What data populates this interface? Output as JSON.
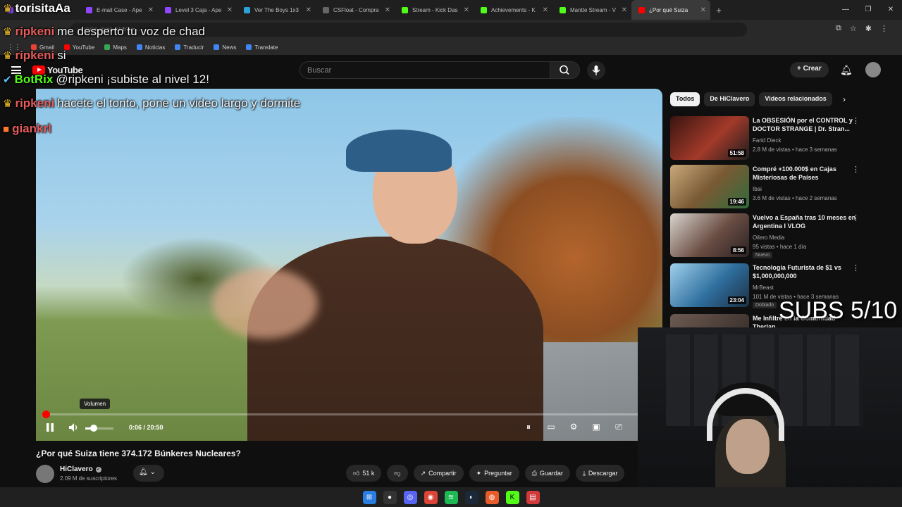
{
  "browser": {
    "tabs": [
      {
        "label": "torisitaAa:",
        "color": "#7b3fe4"
      },
      {
        "label": "E-mail Case - Ape",
        "color": "#9146ff"
      },
      {
        "label": "Level 3 Caja - Ape",
        "color": "#9146ff"
      },
      {
        "label": "Ver The Boys 1x3",
        "color": "#2aa3d8"
      },
      {
        "label": "CSFloat - Compra",
        "color": "#666666"
      },
      {
        "label": "Stream - Kick Das",
        "color": "#53fc18"
      },
      {
        "label": "Achievements - K",
        "color": "#53fc18"
      },
      {
        "label": "Mantte Stream - V",
        "color": "#53fc18"
      },
      {
        "label": "¿Por qué Suiza",
        "color": "#ff0000",
        "active": true
      }
    ],
    "new_tab": "+",
    "url": "youtube.com/watch?v=...",
    "bookmarks": [
      {
        "label": "Gmail",
        "color": "#ea4335"
      },
      {
        "label": "YouTube",
        "color": "#ff0000"
      },
      {
        "label": "Maps",
        "color": "#34a853"
      },
      {
        "label": "Noticias",
        "color": "#4285f4"
      },
      {
        "label": "Traducir",
        "color": "#4285f4"
      },
      {
        "label": "News",
        "color": "#4285f4"
      },
      {
        "label": "Translate",
        "color": "#4285f4"
      }
    ]
  },
  "youtube": {
    "logo_text": "YouTube",
    "search_placeholder": "Buscar",
    "create_label": "+ Crear",
    "video": {
      "title": "¿Por qué Suiza tiene 374.172 Búnkeres Nucleares?",
      "current_time": "0:06",
      "duration": "20:50",
      "time_display": "0:06 / 20:50",
      "progress": 0.005,
      "volume": 0.3,
      "volume_tooltip": "Volumen"
    },
    "channel": {
      "name": "HiClavero",
      "subscribers": "2.09 M de suscriptores"
    },
    "actions": {
      "likes": "51 k",
      "share": "Compartir",
      "ask": "Preguntar",
      "save": "Guardar",
      "download": "Descargar"
    },
    "chips": [
      "Todos",
      "De HiClavero",
      "Videos relacionados"
    ],
    "recommendations": [
      {
        "title": "La OBSESIÓN por el CONTROL y DOCTOR STRANGE | Dr. Stran...",
        "channel": "Farid Dieck",
        "meta": "2.8 M de vistas • hace 3 semanas",
        "duration": "51:58",
        "thumb": "#6c2a24"
      },
      {
        "title": "Compré +100.000$ en Cajas Misteriosas de Países",
        "channel": "Ibai",
        "meta": "3.6 M de vistas • hace 2 semanas",
        "duration": "19:46",
        "thumb": "#8b6a3a"
      },
      {
        "title": "Vuelvo a España tras 10 meses en Argentina I VLOG",
        "channel": "Oilero Media",
        "meta": "95 vistas • hace 1 día",
        "duration": "8:56",
        "badge": "Nuevo",
        "thumb": "#5b4a44"
      },
      {
        "title": "Tecnologia Futurista de $1 vs $1,000,000,000",
        "channel": "MrBeast",
        "meta": "101 M de vistas • hace 3 semanas",
        "duration": "23:04",
        "badge": "Doblado",
        "thumb": "#3a6c9a"
      },
      {
        "title": "Me Infiltré en la Comunidad Therian",
        "channel": "",
        "meta": "",
        "duration": "",
        "thumb": "#4a3c3a"
      }
    ]
  },
  "overlay": {
    "chat": [
      {
        "user": "torisitaAa",
        "message": ""
      },
      {
        "user": "ripkeni",
        "message": "me desperto tu voz de chad"
      },
      {
        "user": "ripkeni",
        "message": "si"
      },
      {
        "user": "BotRix",
        "message": "@ripkeni ¡subiste al nivel 12!"
      },
      {
        "user": "ripkeni",
        "message": "hacete el tonto, pone un video largo y dormite"
      },
      {
        "user": "giankrl",
        "message": ""
      }
    ],
    "subs_goal": "SUBS 5/10"
  }
}
